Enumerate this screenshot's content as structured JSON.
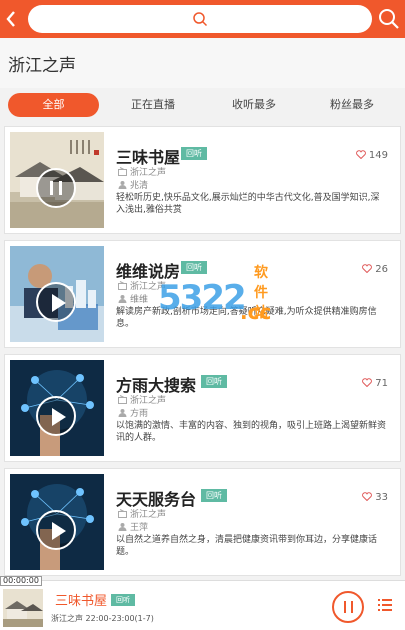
{
  "header": {
    "back_icon": "chevron-left-icon",
    "search_placeholder": "",
    "search_icon": "search-icon"
  },
  "station": {
    "title": "浙江之声"
  },
  "tabs": [
    {
      "label": "全部",
      "active": true
    },
    {
      "label": "正在直播",
      "active": false
    },
    {
      "label": "收听最多",
      "active": false
    },
    {
      "label": "粉丝最多",
      "active": false
    }
  ],
  "programs": [
    {
      "title": "三味书屋",
      "badge": "回听",
      "likes": "149",
      "station": "浙江之声",
      "host": "兆清",
      "desc": "轻松听历史,快乐品文化,展示灿烂的中华古代文化,普及国学知识,深入浅出,雅俗共赏",
      "playing": true
    },
    {
      "title": "维维说房",
      "badge": "回听",
      "likes": "26",
      "station": "浙江之声",
      "host": "维维",
      "desc": "解读房产新政,剖析市场走向,答疑听众疑难,为听众提供精准购房信息。",
      "playing": false
    },
    {
      "title": "方雨大搜索",
      "badge": "回听",
      "likes": "71",
      "station": "浙江之声",
      "host": "方雨",
      "desc": "以饱满的激情、丰富的内容、独到的视角，吸引上班路上渴望新鲜资讯的人群。",
      "playing": false
    },
    {
      "title": "天天服务台",
      "badge": "回听",
      "likes": "33",
      "station": "浙江之声",
      "host": "王萍",
      "desc": "以自然之道养自然之身，清晨把健康资讯带到你耳边，分享健康话题。",
      "playing": false
    }
  ],
  "watermark": {
    "text": "软件站",
    "big": "5322",
    "cc": ".cc"
  },
  "player": {
    "time": "00:00:00",
    "title": "三味书屋",
    "badge": "回听",
    "subtitle": "浙江之声 22:00-23:00(1-7)",
    "pause_icon": "pause-icon",
    "list_icon": "playlist-icon"
  },
  "colors": {
    "accent": "#f0582c",
    "badge": "#5fbaa3"
  }
}
